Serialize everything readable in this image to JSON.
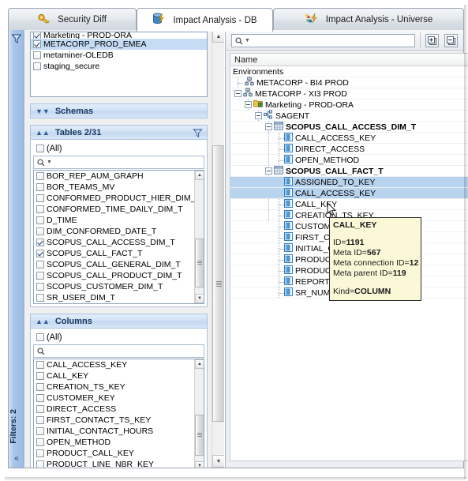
{
  "window": {
    "tabs": [
      {
        "label": "Security Diff",
        "icon": "key-icon",
        "active": false
      },
      {
        "label": "Impact Analysis - DB",
        "icon": "database-bolt-icon",
        "active": true
      },
      {
        "label": "Impact Analysis - Universe",
        "icon": "universe-bolt-icon",
        "active": false
      }
    ]
  },
  "filter_rail": {
    "label": "Filters: 2",
    "icon": "funnel-icon",
    "collapse_icon": "double-chevron-left-icon"
  },
  "left_panel": {
    "connections": {
      "items": [
        {
          "label": "Marketing - PROD-ORA",
          "checked": true,
          "selected": false,
          "clipped": true
        },
        {
          "label": "METACORP_PROD_EMEA",
          "checked": true,
          "selected": true
        },
        {
          "label": "metaminer-OLEDB",
          "checked": false,
          "selected": false
        },
        {
          "label": "staging_secure",
          "checked": false,
          "selected": false
        }
      ]
    },
    "schemas": {
      "title": "Schemas",
      "expanded": false,
      "chevron": "chevron-double-down-icon"
    },
    "tables": {
      "title": "Tables 2/31",
      "expanded": true,
      "chevron": "chevron-double-up-icon",
      "funnel_icon": "funnel-icon",
      "all_label": "(All)",
      "all_checked": false,
      "search_placeholder": "",
      "search_value": "",
      "items": [
        {
          "label": "BOR_REP_AUM_GRAPH",
          "checked": false
        },
        {
          "label": "BOR_TEAMS_MV",
          "checked": false
        },
        {
          "label": "CONFORMED_PRODUCT_HIER_DIM_T",
          "checked": false
        },
        {
          "label": "CONFORMED_TIME_DAILY_DIM_T",
          "checked": false
        },
        {
          "label": "D_TIME",
          "checked": false
        },
        {
          "label": "DIM_CONFORMED_DATE_T",
          "checked": false
        },
        {
          "label": "SCOPUS_CALL_ACCESS_DIM_T",
          "checked": true
        },
        {
          "label": "SCOPUS_CALL_FACT_T",
          "checked": true
        },
        {
          "label": "SCOPUS_CALL_GENERAL_DIM_T",
          "checked": false
        },
        {
          "label": "SCOPUS_CALL_PRODUCT_DIM_T",
          "checked": false
        },
        {
          "label": "SCOPUS_CUSTOMER_DIM_T",
          "checked": false
        },
        {
          "label": "SR_USER_DIM_T",
          "checked": false
        }
      ]
    },
    "columns": {
      "title": "Columns",
      "expanded": true,
      "chevron": "chevron-double-up-icon",
      "all_label": "(All)",
      "all_checked": false,
      "search_placeholder": "",
      "search_value": "",
      "items": [
        {
          "label": "CALL_ACCESS_KEY",
          "checked": false
        },
        {
          "label": "CALL_KEY",
          "checked": false
        },
        {
          "label": "CREATION_TS_KEY",
          "checked": false
        },
        {
          "label": "CUSTOMER_KEY",
          "checked": false
        },
        {
          "label": "DIRECT_ACCESS",
          "checked": false
        },
        {
          "label": "FIRST_CONTACT_TS_KEY",
          "checked": false
        },
        {
          "label": "INITIAL_CONTACT_HOURS",
          "checked": false
        },
        {
          "label": "OPEN_METHOD",
          "checked": false
        },
        {
          "label": "PRODUCT_CALL_KEY",
          "checked": false
        },
        {
          "label": "PRODUCT_LINE_NBR_KEY",
          "checked": false
        }
      ]
    }
  },
  "right_panel": {
    "toolbar": {
      "search_value": "",
      "search_icon": "search-dropdown-icon",
      "expand_all_icon": "expand-all-icon",
      "collapse_all_icon": "collapse-all-icon"
    },
    "column_header": "Name",
    "tree": [
      {
        "label": "Environments",
        "depth": 0,
        "icon": "none",
        "expander": "none",
        "bold": false,
        "selected": false
      },
      {
        "label": "METACORP - BI4 PROD",
        "depth": 1,
        "icon": "server-icon",
        "expander": "none",
        "bold": false,
        "selected": false
      },
      {
        "label": "METACORP - XI3 PROD",
        "depth": 1,
        "icon": "server-icon",
        "expander": "collapse",
        "bold": false,
        "selected": false
      },
      {
        "label": "Marketing - PROD-ORA",
        "depth": 2,
        "icon": "folder-db-icon",
        "expander": "collapse",
        "bold": false,
        "selected": false
      },
      {
        "label": "SAGENT",
        "depth": 3,
        "icon": "connection-icon",
        "expander": "collapse",
        "bold": false,
        "selected": false
      },
      {
        "label": "SCOPUS_CALL_ACCESS_DIM_T",
        "depth": 4,
        "icon": "table-icon",
        "expander": "collapse",
        "bold": true,
        "selected": false
      },
      {
        "label": "CALL_ACCESS_KEY",
        "depth": 5,
        "icon": "column-icon",
        "expander": "none",
        "bold": false,
        "selected": false
      },
      {
        "label": "DIRECT_ACCESS",
        "depth": 5,
        "icon": "column-icon",
        "expander": "none",
        "bold": false,
        "selected": false
      },
      {
        "label": "OPEN_METHOD",
        "depth": 5,
        "icon": "column-icon",
        "expander": "none",
        "bold": false,
        "selected": false
      },
      {
        "label": "SCOPUS_CALL_FACT_T",
        "depth": 4,
        "icon": "table-icon",
        "expander": "collapse",
        "bold": true,
        "selected": false
      },
      {
        "label": "ASSIGNED_TO_KEY",
        "depth": 5,
        "icon": "column-icon",
        "expander": "none",
        "bold": false,
        "selected": true
      },
      {
        "label": "CALL_ACCESS_KEY",
        "depth": 5,
        "icon": "column-icon",
        "expander": "none",
        "bold": false,
        "selected": true
      },
      {
        "label": "CALL_KEY",
        "depth": 5,
        "icon": "column-icon",
        "expander": "none",
        "bold": false,
        "selected": false
      },
      {
        "label": "CREATION_TS_KEY",
        "depth": 5,
        "icon": "column-icon",
        "expander": "none",
        "bold": false,
        "selected": false
      },
      {
        "label": "CUSTOMER_KEY",
        "depth": 5,
        "icon": "column-icon",
        "expander": "none",
        "bold": false,
        "selected": false
      },
      {
        "label": "FIRST_CONTACT_TS_KEY",
        "depth": 5,
        "icon": "column-icon",
        "expander": "none",
        "bold": false,
        "selected": false
      },
      {
        "label": "INITIAL_CONTACT_HOURS",
        "depth": 5,
        "icon": "column-icon",
        "expander": "none",
        "bold": false,
        "selected": false
      },
      {
        "label": "PRODUCT_CALL_KEY",
        "depth": 5,
        "icon": "column-icon",
        "expander": "none",
        "bold": false,
        "selected": false
      },
      {
        "label": "PRODUCT_LINE_NBR_KEY",
        "depth": 5,
        "icon": "column-icon",
        "expander": "none",
        "bold": false,
        "selected": false
      },
      {
        "label": "REPORTER_KEY",
        "depth": 5,
        "icon": "column-icon",
        "expander": "none",
        "bold": false,
        "selected": false
      },
      {
        "label": "SR_NUM",
        "depth": 5,
        "icon": "column-icon",
        "expander": "none",
        "bold": false,
        "selected": false
      }
    ]
  },
  "tooltip": {
    "title": "CALL_KEY",
    "lines": [
      {
        "key": "ID=",
        "value": "1191"
      },
      {
        "key": "Meta ID=",
        "value": "567"
      },
      {
        "key": "Meta connection ID=",
        "value": "12"
      },
      {
        "key": "Meta parent ID=",
        "value": "119"
      }
    ],
    "kind_key": "Kind=",
    "kind_value": "COLUMN"
  },
  "colors": {
    "selection_blue": "#b8d3ee",
    "list_selection": "#c5dcf5",
    "section_header": "#cfe0f4",
    "tooltip_bg": "#fbf8d8",
    "rail_blue": "#9dbbe4"
  }
}
